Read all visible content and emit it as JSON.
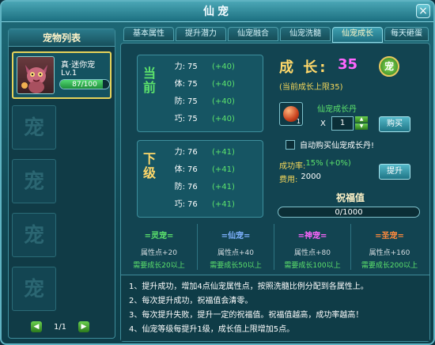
{
  "window": {
    "title": "仙宠",
    "close_label": "×"
  },
  "pet_list": {
    "title": "宠物列表",
    "selected_pet": {
      "name": "真·迷你宠",
      "level_text": "Lv.1",
      "exp_text": "87/100",
      "exp_fraction": 0.87
    },
    "empty_slot_char": "宠",
    "pager": {
      "prev": "◀",
      "text": "1/1",
      "next": "▶"
    }
  },
  "tabs": [
    "基本属性",
    "提升潜力",
    "仙宠融合",
    "仙宠洗髓",
    "仙宠成长",
    "每天砸蛋"
  ],
  "active_tab_index": 4,
  "current": {
    "label": "当前",
    "stats": [
      {
        "name": "力:",
        "value": "75",
        "bonus": "(+40)"
      },
      {
        "name": "体:",
        "value": "75",
        "bonus": "(+40)"
      },
      {
        "name": "防:",
        "value": "75",
        "bonus": "(+40)"
      },
      {
        "name": "巧:",
        "value": "75",
        "bonus": "(+40)"
      }
    ]
  },
  "next": {
    "label": "下级",
    "stats": [
      {
        "name": "力:",
        "value": "76",
        "bonus": "(+41)"
      },
      {
        "name": "体:",
        "value": "76",
        "bonus": "(+41)"
      },
      {
        "name": "防:",
        "value": "76",
        "bonus": "(+41)"
      },
      {
        "name": "巧:",
        "value": "76",
        "bonus": "(+41)"
      }
    ]
  },
  "growth": {
    "title": "成 长:",
    "value": "35",
    "emblem_char": "宠",
    "limit_text": "(当前成长上限35)"
  },
  "item": {
    "name": "仙宠成长丹",
    "count": "1",
    "qty_x": "X",
    "qty_value": "1",
    "stepper_up": "▲",
    "stepper_down": "▼",
    "buy_label": "购买"
  },
  "auto_buy": {
    "label": "自动购买仙宠成长丹!",
    "checked": false
  },
  "success_rate": {
    "label": "成功率:",
    "value": "15% (+0%)"
  },
  "cost": {
    "label": "费用:",
    "value": "2000"
  },
  "upgrade_label": "提升",
  "blessing": {
    "title": "祝福值",
    "text": "0/1000",
    "fraction": 0
  },
  "ranks": [
    {
      "name": "=灵宠=",
      "points": "属性点+20",
      "requirement": "需要成长20以上",
      "color": "#5ce26c"
    },
    {
      "name": "=仙宠=",
      "points": "属性点+40",
      "requirement": "需要成长50以上",
      "color": "#7fb2ff"
    },
    {
      "name": "=神宠=",
      "points": "属性点+80",
      "requirement": "需要成长100以上",
      "color": "#ff66ff"
    },
    {
      "name": "=圣宠=",
      "points": "属性点+160",
      "requirement": "需要成长200以上",
      "color": "#ff8a3d"
    }
  ],
  "rules": [
    "1、提升成功，增加4点仙宠属性点，按照洗髓比例分配到各属性上。",
    "2、每次提升成功，祝福值会清零。",
    "3、每次提升失败，提升一定的祝福值。祝福值越高，成功率越高！",
    "4、仙宠等级每提升1级，成长值上限增加5点。"
  ]
}
